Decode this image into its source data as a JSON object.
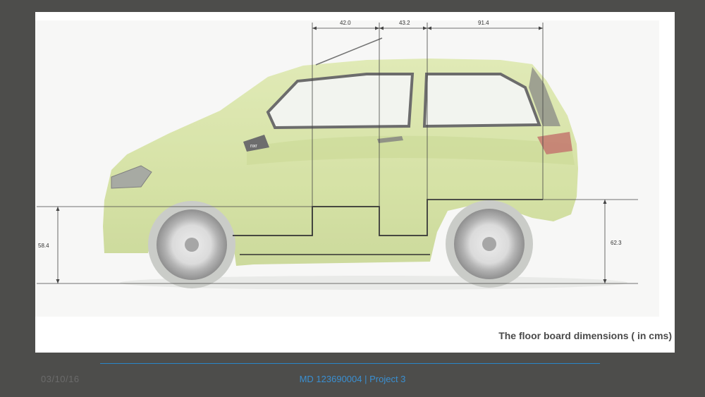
{
  "diagram": {
    "top_dimensions": [
      "42.0",
      "43.2",
      "91.4"
    ],
    "left_height": "58.4",
    "right_height": "62.3",
    "badge_text": "nxr"
  },
  "caption": "The floor board dimensions ( in cms)",
  "footer": {
    "date": "03/10/16",
    "center_text": "MD 123690004 | Project 3"
  },
  "colors": {
    "background": "#4d4d4b",
    "car_body": "#c6d782",
    "accent_line": "#2a86c8"
  }
}
